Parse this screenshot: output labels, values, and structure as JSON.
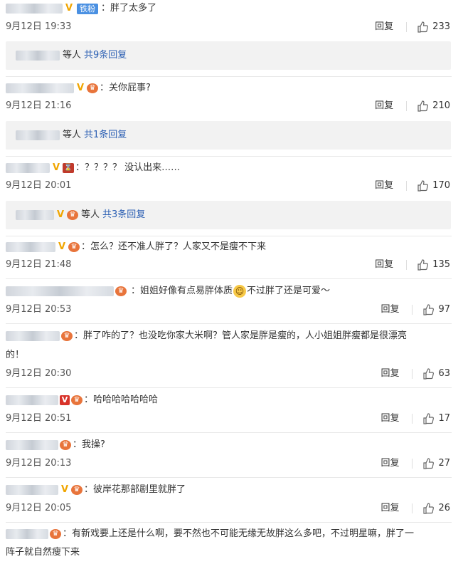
{
  "comments": [
    {
      "text": "：胖了太多了",
      "date": "9月12日 19:33",
      "reply": "回复",
      "likes": "233",
      "badge": "铁粉",
      "sub": {
        "pre": "等人",
        "link": "共9条回复"
      }
    },
    {
      "text": "：关你屁事?",
      "date": "9月12日 21:16",
      "reply": "回复",
      "likes": "210",
      "sub": {
        "pre": "等人",
        "link": "共1条回复"
      }
    },
    {
      "text": "：？？？？ 没认出来……",
      "date": "9月12日 20:01",
      "reply": "回复",
      "likes": "170",
      "sub": {
        "pre": "等人",
        "link": "共3条回复"
      }
    },
    {
      "text": "：怎么？还不准人胖了？人家又不是瘦不下来",
      "date": "9月12日 21:48",
      "reply": "回复",
      "likes": "135"
    },
    {
      "text": "：姐姐好像有点易胖体质",
      "text_tail": "不过胖了还是可爱～",
      "date": "9月12日 20:53",
      "reply": "回复",
      "likes": "97"
    },
    {
      "text": "：胖了咋的了？也没吃你家大米啊？管人家是胖是瘦的，人小姐姐胖瘦都是很漂亮",
      "text_line2": "的！",
      "date": "9月12日 20:30",
      "reply": "回复",
      "likes": "63"
    },
    {
      "text": "：哈哈哈哈哈哈哈",
      "date": "9月12日 20:51",
      "reply": "回复",
      "likes": "17"
    },
    {
      "text": "：我操?",
      "date": "9月12日 20:13",
      "reply": "回复",
      "likes": "27"
    },
    {
      "text": "：彼岸花那部剧里就胖了",
      "date": "9月12日 20:05",
      "reply": "回复",
      "likes": "26"
    },
    {
      "text": "：有新戏要上还是什么啊，要不然也不可能无缘无故胖这么多吧，不过明星嘛，胖了一",
      "text_line2": "阵子就自然瘦下来"
    }
  ],
  "icons": {
    "like": "thumbs-up-icon",
    "badge_v": "v-verified-icon",
    "medal": "fan-medal-icon",
    "emoji": "laughing-emoji-icon"
  },
  "colors": {
    "link": "#2b5fb3",
    "subbox": "#f2f2f2",
    "badge_blue": "#4a90e2",
    "verified": "#f0a500"
  }
}
